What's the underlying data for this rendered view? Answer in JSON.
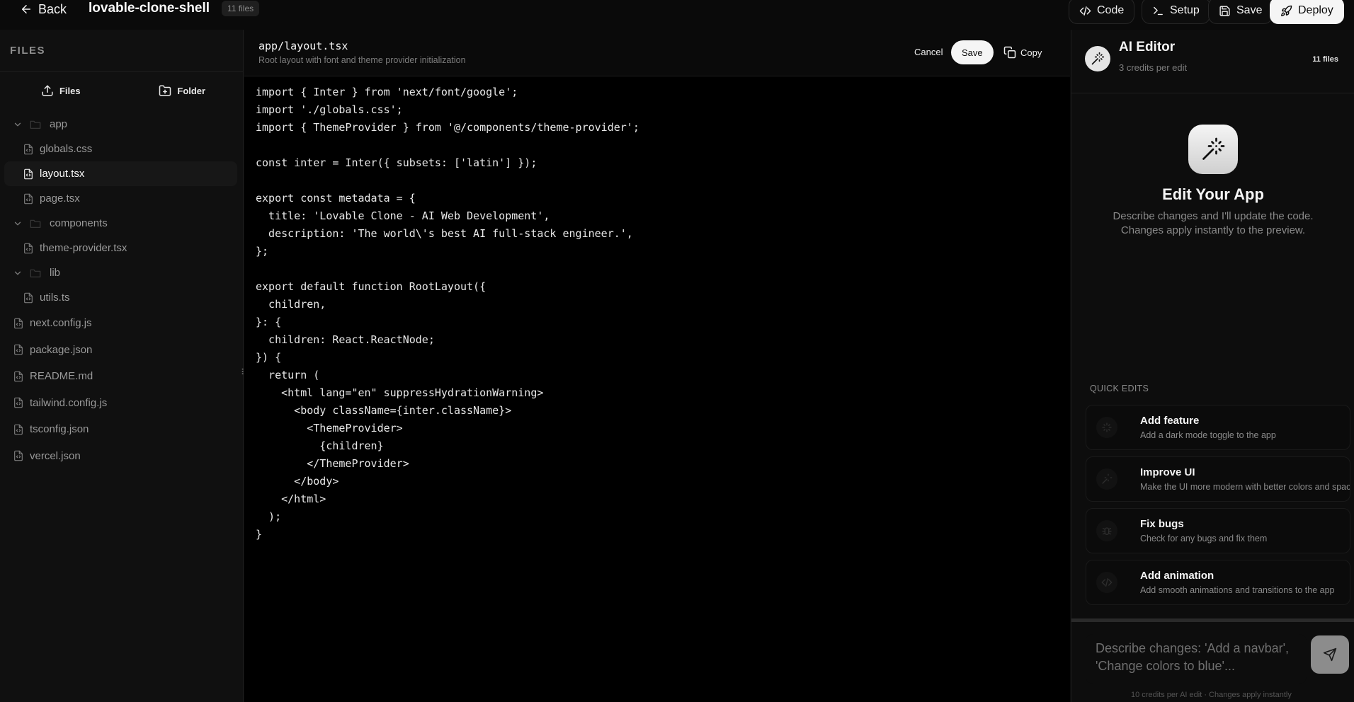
{
  "topbar": {
    "back_label": "Back",
    "project_name": "lovable-clone-shell",
    "file_count": "11 files",
    "code_label": "Code",
    "setup_label": "Setup",
    "save_label": "Save",
    "deploy_label": "Deploy"
  },
  "sidebar": {
    "header": "FILES",
    "files_btn": "Files",
    "folder_btn": "Folder",
    "tree": {
      "app": {
        "name": "app",
        "children": [
          "globals.css",
          "layout.tsx",
          "page.tsx"
        ]
      },
      "components": {
        "name": "components",
        "children": [
          "theme-provider.tsx"
        ]
      },
      "lib": {
        "name": "lib",
        "children": [
          "utils.ts"
        ]
      },
      "root_files": [
        "next.config.js",
        "package.json",
        "README.md",
        "tailwind.config.js",
        "tsconfig.json",
        "vercel.json"
      ]
    },
    "selected": "layout.tsx"
  },
  "editor": {
    "path": "app/layout.tsx",
    "description": "Root layout with font and theme provider initialization",
    "cancel_label": "Cancel",
    "save_label": "Save",
    "copy_label": "Copy",
    "code": "import { Inter } from 'next/font/google';\nimport './globals.css';\nimport { ThemeProvider } from '@/components/theme-provider';\n\nconst inter = Inter({ subsets: ['latin'] });\n\nexport const metadata = {\n  title: 'Lovable Clone - AI Web Development',\n  description: 'The world\\'s best AI full-stack engineer.',\n};\n\nexport default function RootLayout({\n  children,\n}: {\n  children: React.ReactNode;\n}) {\n  return (\n    <html lang=\"en\" suppressHydrationWarning>\n      <body className={inter.className}>\n        <ThemeProvider>\n          {children}\n        </ThemeProvider>\n      </body>\n    </html>\n  );\n}"
  },
  "ai": {
    "title": "AI Editor",
    "subtitle": "3 credits per edit",
    "badge": "11 files",
    "hero_title": "Edit Your App",
    "hero_desc_1": "Describe changes and I'll update the code.",
    "hero_desc_2": "Changes apply instantly to the preview.",
    "quick_edits_label": "QUICK EDITS",
    "quick_edits": [
      {
        "title": "Add feature",
        "desc": "Add a dark mode toggle to the app",
        "icon": "sparkle-icon"
      },
      {
        "title": "Improve UI",
        "desc": "Make the UI more modern with better colors and spacing",
        "icon": "wand-icon"
      },
      {
        "title": "Fix bugs",
        "desc": "Check for any bugs and fix them",
        "icon": "bug-icon"
      },
      {
        "title": "Add animation",
        "desc": "Add smooth animations and transitions to the app",
        "icon": "code-icon"
      }
    ],
    "input_placeholder": "Describe changes: 'Add a navbar', 'Change colors to blue'...",
    "footer": "10 credits per AI edit · Changes apply instantly"
  }
}
